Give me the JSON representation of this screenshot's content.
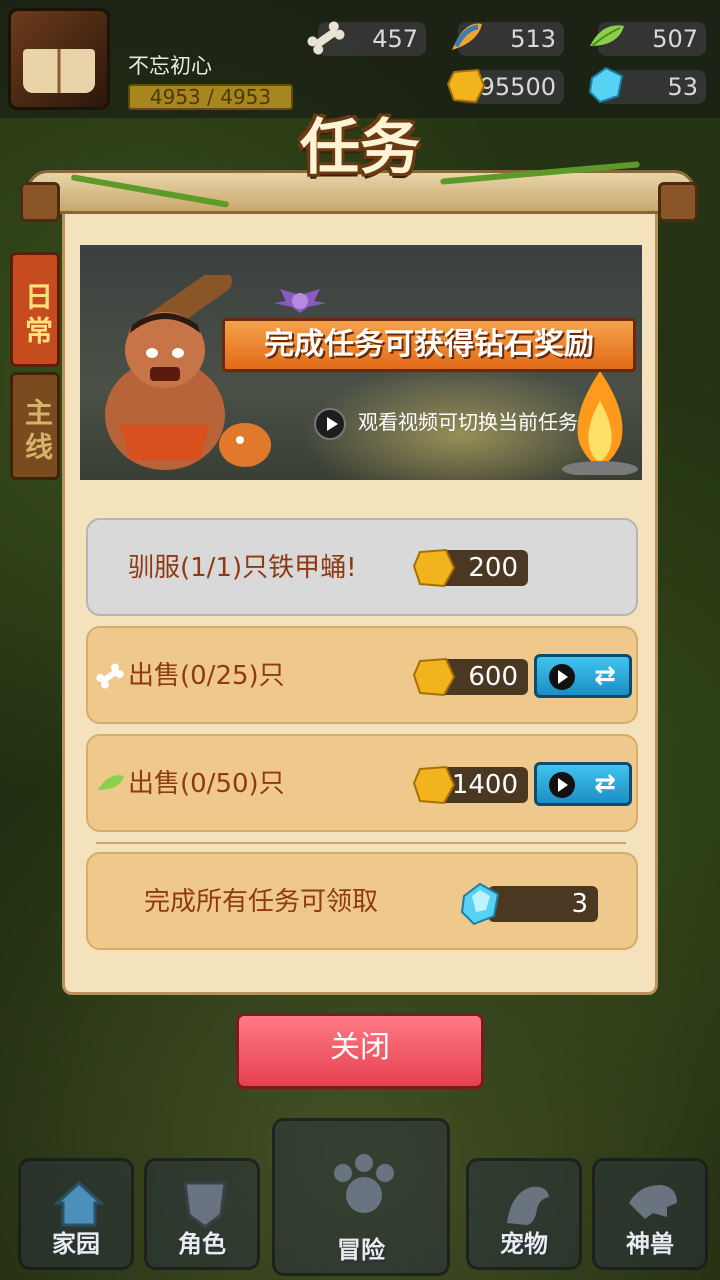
{
  "player": {
    "name": "不忘初心",
    "xp": "4953 / 4953"
  },
  "resources": {
    "bone": "457",
    "fish": "513",
    "leaf": "507",
    "gold": "95500",
    "diamond": "53"
  },
  "side_tabs": {
    "daily": "日常",
    "main": "主线"
  },
  "dialog": {
    "title": "任务",
    "banner_headline": "完成任务可获得钻石奖励",
    "video_hint": "观看视频可切换当前任务"
  },
  "tasks": [
    {
      "text": "驯服(1/1)只铁甲蛹!",
      "reward": "200",
      "icon": ""
    },
    {
      "text": "出售(0/25)只",
      "reward": "600",
      "icon": "bone-icon"
    },
    {
      "text": "出售(0/50)只",
      "reward": "1400",
      "icon": "leaf-icon"
    }
  ],
  "bonus": {
    "text": "完成所有任务可领取",
    "reward": "3"
  },
  "close_label": "关闭",
  "nav": {
    "home": "家园",
    "role": "角色",
    "adventure": "冒险",
    "pet": "宠物",
    "beast": "神兽"
  },
  "colors": {
    "accent_red": "#e5414f",
    "panel": "#f3e2bc",
    "task_open": "#efc98c",
    "task_done": "#d9d9d9",
    "text_brown": "#8f3a12",
    "swap_blue": "#1c8ec5"
  }
}
